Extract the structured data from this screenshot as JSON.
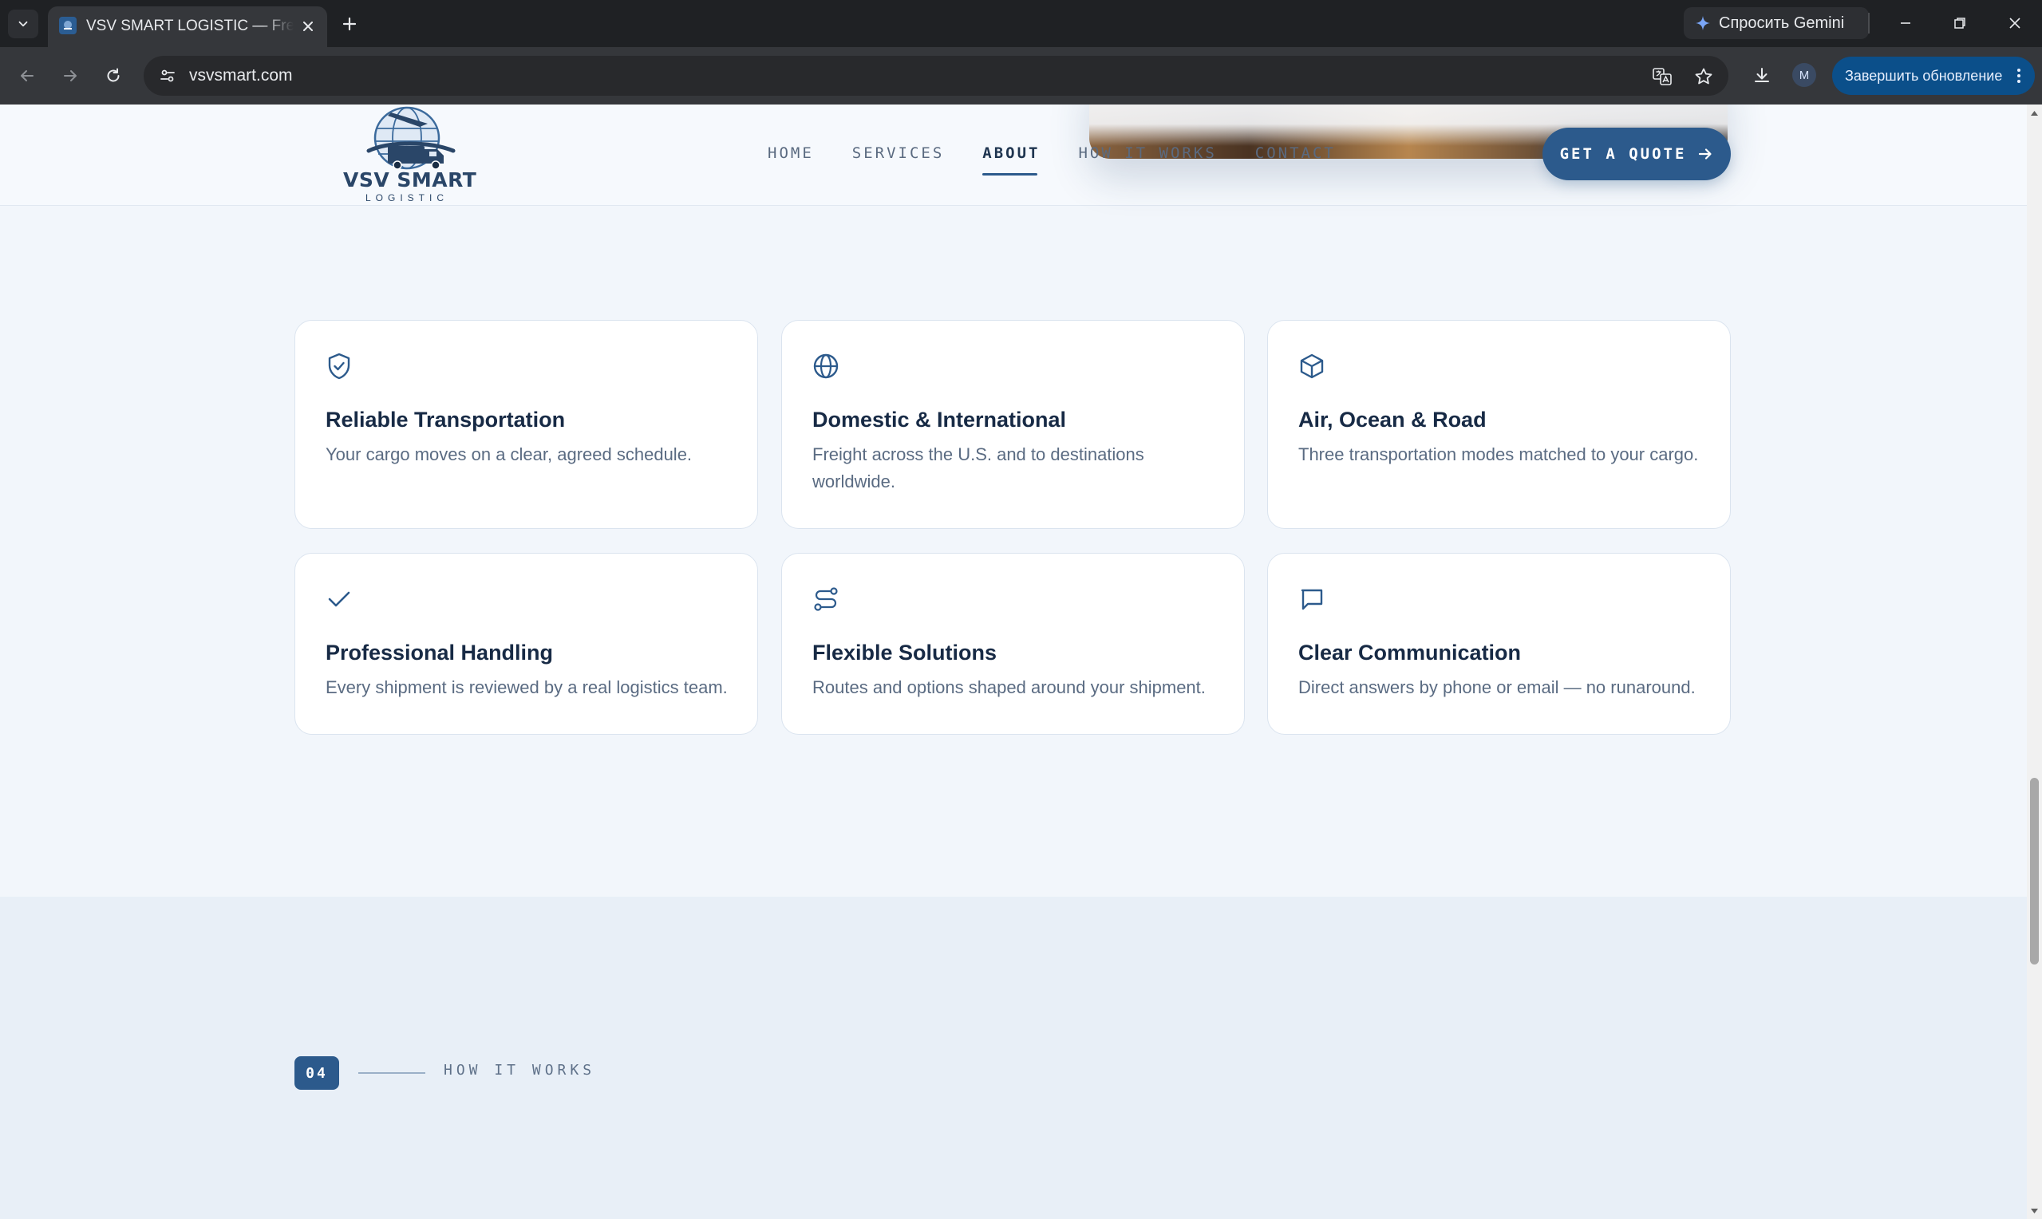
{
  "browser": {
    "tab_title": "VSV SMART LOGISTIC — Freight",
    "url": "vsvsmart.com",
    "gemini_label": "Спросить Gemini",
    "update_label": "Завершить обновление",
    "profile_initial": "M"
  },
  "header": {
    "logo_main": "VSV SMART",
    "logo_sub": "LOGISTIC",
    "nav": [
      "HOME",
      "SERVICES",
      "ABOUT",
      "HOW IT WORKS",
      "CONTACT"
    ],
    "active_nav": "ABOUT",
    "cta_label": "GET A QUOTE"
  },
  "features": [
    {
      "icon": "shield-check-icon",
      "title": "Reliable Transportation",
      "desc": "Your cargo moves on a clear, agreed schedule."
    },
    {
      "icon": "globe-icon",
      "title": "Domestic & International",
      "desc": "Freight across the U.S. and to destinations worldwide."
    },
    {
      "icon": "box-icon",
      "title": "Air, Ocean & Road",
      "desc": "Three transportation modes matched to your cargo."
    },
    {
      "icon": "check-icon",
      "title": "Professional Handling",
      "desc": "Every shipment is reviewed by a real logistics team."
    },
    {
      "icon": "route-icon",
      "title": "Flexible Solutions",
      "desc": "Routes and options shaped around your shipment."
    },
    {
      "icon": "message-icon",
      "title": "Clear Communication",
      "desc": "Direct answers by phone or email — no runaround."
    }
  ],
  "how_it_works": {
    "step_number": "04",
    "label": "HOW IT WORKS"
  },
  "colors": {
    "brand": "#2c5a8c",
    "heading": "#172a45",
    "body_text": "#5a6b82",
    "page_bg": "#f2f6fb"
  }
}
